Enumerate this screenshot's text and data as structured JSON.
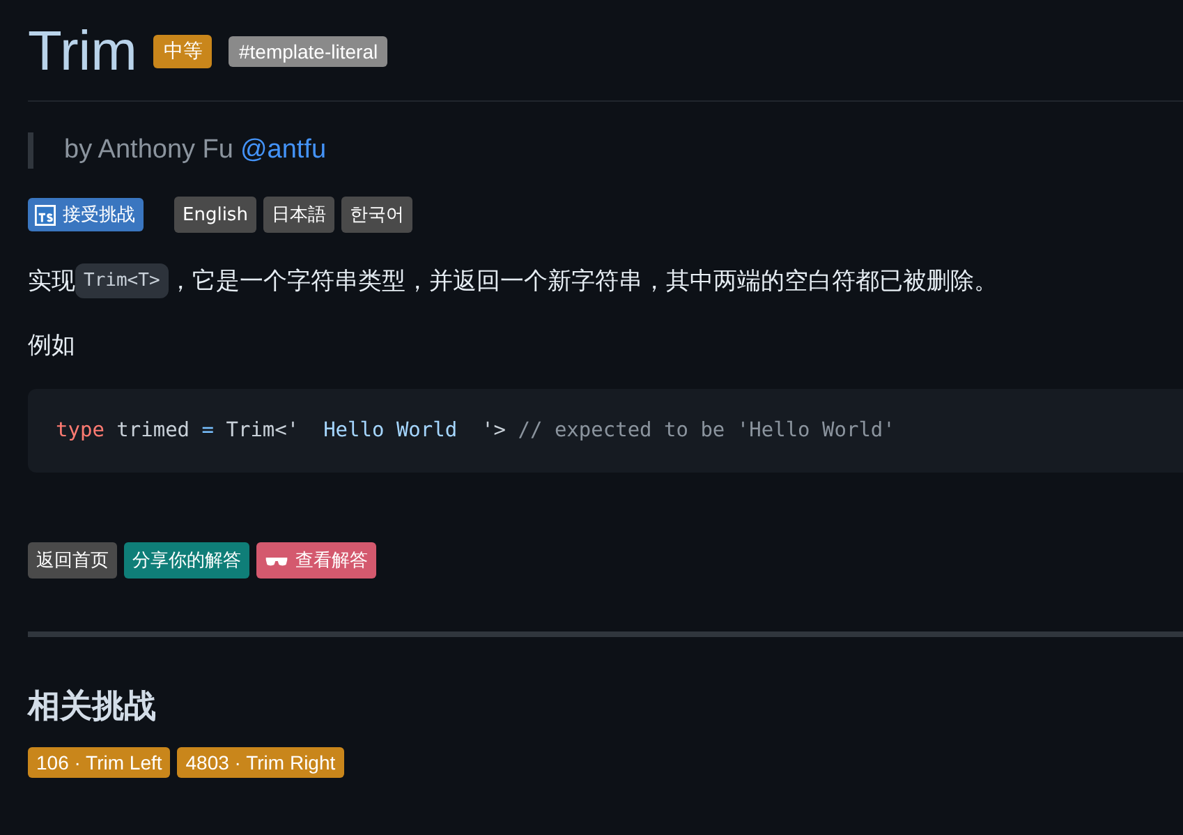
{
  "title": "Trim",
  "badges": [
    {
      "label": "中等",
      "kind": "difficulty"
    },
    {
      "label": "#template-literal",
      "kind": "tag"
    }
  ],
  "author": {
    "prefix": "by Anthony Fu",
    "handle": "@antfu"
  },
  "challenge_button": "接受挑战",
  "languages": [
    "English",
    "日本語",
    "한국어"
  ],
  "description": {
    "before": "实现",
    "code": "Trim<T>",
    "after": "，它是一个字符串类型，并返回一个新字符串，其中两端的空白符都已被删除。"
  },
  "example_label": "例如",
  "code": [
    {
      "text": "type",
      "kind": "keyword"
    },
    {
      "text": " trimed ",
      "kind": "plain"
    },
    {
      "text": "=",
      "kind": "operator"
    },
    {
      "text": " Trim<'",
      "kind": "plain"
    },
    {
      "text": "  Hello World  ",
      "kind": "string"
    },
    {
      "text": "'>",
      "kind": "plain"
    },
    {
      "text": " // expected to be 'Hello World'",
      "kind": "comment"
    }
  ],
  "actions": [
    {
      "label": "返回首页",
      "color": "#4a4a4a",
      "icon": false
    },
    {
      "label": "分享你的解答",
      "color": "#0f7e78",
      "icon": false
    },
    {
      "label": "查看解答",
      "color": "#d4596e",
      "icon": true
    }
  ],
  "related_heading": "相关挑战",
  "related": [
    "106 · Trim Left",
    "4803 · Trim Right"
  ]
}
